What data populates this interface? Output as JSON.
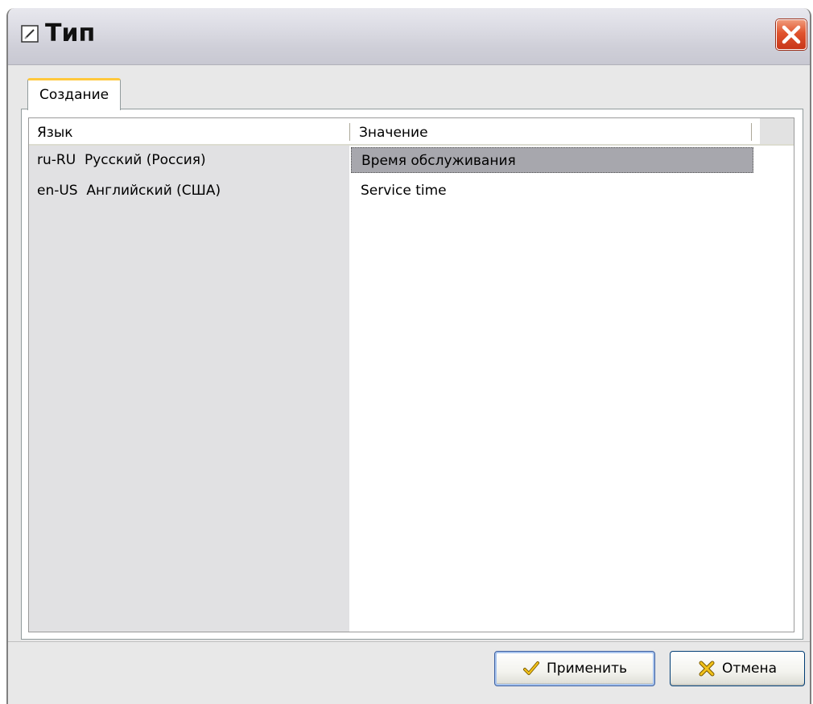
{
  "window": {
    "title": "Тип"
  },
  "tabs": [
    {
      "label": "Создание"
    }
  ],
  "grid": {
    "columns": [
      "Язык",
      "Значение"
    ],
    "rows": [
      {
        "code": "ru-RU",
        "language": "Русский (Россия)",
        "value": "Время обслуживания",
        "selected": true
      },
      {
        "code": "en-US",
        "language": "Английский (США)",
        "value": "Service time",
        "selected": false
      }
    ]
  },
  "buttons": {
    "apply_label": "Применить",
    "cancel_label": "Отмена"
  },
  "icons": {
    "title": "edit-icon",
    "close": "close-icon",
    "apply": "checkmark-icon",
    "cancel": "cross-icon"
  }
}
